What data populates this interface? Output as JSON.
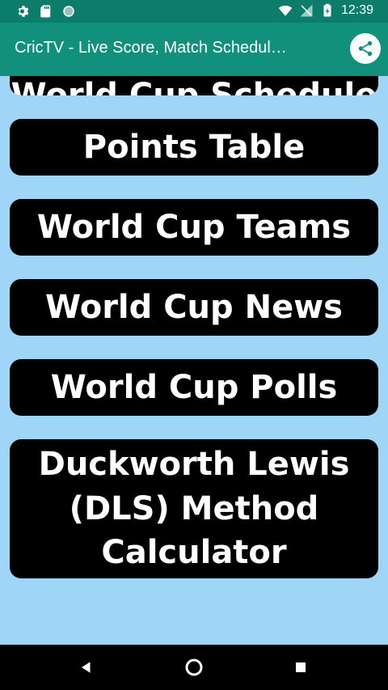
{
  "status_bar": {
    "time": "12:39",
    "left_icons": [
      "gear-icon",
      "sd-card-icon",
      "circle-icon"
    ],
    "right_icons": [
      "wifi-icon",
      "no-signal-icon",
      "battery-icon"
    ]
  },
  "app_bar": {
    "title": "CricTV - Live Score, Match Schedul…",
    "share_icon": "share-icon"
  },
  "menu": {
    "items": [
      {
        "label": "World Cup Schedule"
      },
      {
        "label": "Points Table"
      },
      {
        "label": "World Cup Teams"
      },
      {
        "label": "World Cup News"
      },
      {
        "label": "World Cup Polls"
      },
      {
        "label": "Duckworth Lewis (DLS) Method Calculator"
      }
    ]
  },
  "nav_bar": {
    "icons": [
      "back-icon",
      "home-icon",
      "recents-icon"
    ]
  },
  "colors": {
    "status_bar": "#0C7C6B",
    "app_bar": "#11917C",
    "background": "#9FD6F8",
    "button": "#000000",
    "button_text": "#FFFFFF"
  }
}
